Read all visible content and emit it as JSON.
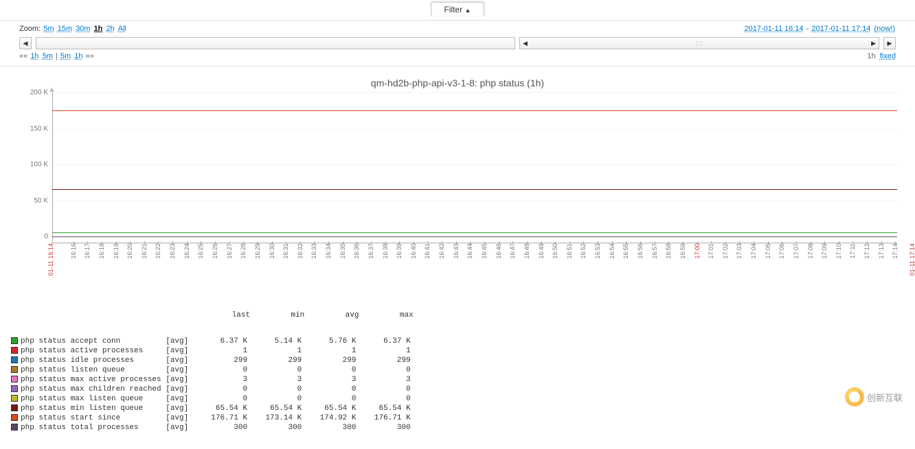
{
  "filter": {
    "label": "Filter",
    "arrow": "▲"
  },
  "zoom": {
    "label": "Zoom:",
    "options": [
      "5m",
      "15m",
      "30m",
      "1h",
      "2h",
      "All"
    ],
    "selected": "1h"
  },
  "period": {
    "from": "2017-01-11 16:14",
    "sep": " - ",
    "to": "2017-01-11 17:14",
    "now": "(now!)"
  },
  "nav": {
    "left_dbl": "««",
    "left_1h": "1h",
    "left_5m": "5m",
    "pipe": " | ",
    "right_5m": "5m",
    "right_1h": "1h",
    "right_dbl": "»»",
    "scale": "1h",
    "fixed": "fixed",
    "btn_left": "◀",
    "btn_right": "▶",
    "grip": ":::"
  },
  "chart_data": {
    "type": "line",
    "title": "qm-hd2b-php-api-v3-1-8: php status (1h)",
    "ylabel": "",
    "xlabel": "",
    "ylim": [
      0,
      200000
    ],
    "y_ticks": [
      0,
      "50 K",
      "100 K",
      "150 K",
      "200 K"
    ],
    "x_ticks": [
      "16:16",
      "16:17",
      "16:18",
      "16:19",
      "16:20",
      "16:21",
      "16:22",
      "16:23",
      "16:24",
      "16:25",
      "16:26",
      "16:27",
      "16:28",
      "16:29",
      "16:30",
      "16:31",
      "16:32",
      "16:33",
      "16:34",
      "16:35",
      "16:36",
      "16:37",
      "16:38",
      "16:39",
      "16:40",
      "16:41",
      "16:42",
      "16:43",
      "16:44",
      "16:45",
      "16:46",
      "16:47",
      "16:48",
      "16:49",
      "16:50",
      "16:51",
      "16:52",
      "16:53",
      "16:54",
      "16:55",
      "16:56",
      "16:57",
      "16:58",
      "16:59",
      "17:00",
      "17:01",
      "17:02",
      "17:03",
      "17:04",
      "17:05",
      "17:06",
      "17:07",
      "17:08",
      "17:09",
      "17:10",
      "17:11",
      "17:12",
      "17:13",
      "17:14"
    ],
    "x_end_labels": {
      "left": "01-11 16:14",
      "right": "01-11 17:14"
    },
    "highlight_tick": "17:00",
    "series": [
      {
        "name": "php status accept conn",
        "color": "#2ca02c",
        "avg": 5760
      },
      {
        "name": "php status active processes",
        "color": "#d62728",
        "avg": 1
      },
      {
        "name": "php status idle processes",
        "color": "#1f77b4",
        "avg": 299
      },
      {
        "name": "php status listen queue",
        "color": "#b07a2b",
        "avg": 0
      },
      {
        "name": "php status max active processes",
        "color": "#e377c2",
        "avg": 3
      },
      {
        "name": "php status max children reached",
        "color": "#9467bd",
        "avg": 0
      },
      {
        "name": "php status max listen queue",
        "color": "#bcbd22",
        "avg": 0
      },
      {
        "name": "php status min listen queue",
        "color": "#7b1113",
        "avg": 65540
      },
      {
        "name": "php status start since",
        "color": "#d84a1b",
        "avg": 174920
      },
      {
        "name": "php status total processes",
        "color": "#5a4668",
        "avg": 300
      }
    ]
  },
  "legend": {
    "headers": [
      "last",
      "min",
      "avg",
      "max"
    ],
    "agg": "[avg]",
    "rows": [
      {
        "color": "#2ca02c",
        "name": "php status accept conn",
        "vals": [
          "6.37 K",
          "5.14 K",
          "5.76 K",
          "6.37 K"
        ]
      },
      {
        "color": "#d62728",
        "name": "php status active processes",
        "vals": [
          "1",
          "1",
          "1",
          "1"
        ]
      },
      {
        "color": "#1f77b4",
        "name": "php status idle processes",
        "vals": [
          "299",
          "299",
          "299",
          "299"
        ]
      },
      {
        "color": "#b07a2b",
        "name": "php status listen queue",
        "vals": [
          "0",
          "0",
          "0",
          "0"
        ]
      },
      {
        "color": "#e377c2",
        "name": "php status max active processes",
        "vals": [
          "3",
          "3",
          "3",
          "3"
        ]
      },
      {
        "color": "#9467bd",
        "name": "php status max children reached",
        "vals": [
          "0",
          "0",
          "0",
          "0"
        ]
      },
      {
        "color": "#bcbd22",
        "name": "php status max listen queue",
        "vals": [
          "0",
          "0",
          "0",
          "0"
        ]
      },
      {
        "color": "#7b1113",
        "name": "php status min listen queue",
        "vals": [
          "65.54 K",
          "65.54 K",
          "65.54 K",
          "65.54 K"
        ]
      },
      {
        "color": "#d84a1b",
        "name": "php status start since",
        "vals": [
          "176.71 K",
          "173.14 K",
          "174.92 K",
          "176.71 K"
        ]
      },
      {
        "color": "#5a4668",
        "name": "php status total processes",
        "vals": [
          "300",
          "300",
          "300",
          "300"
        ]
      }
    ]
  },
  "watermark": "创新互联"
}
